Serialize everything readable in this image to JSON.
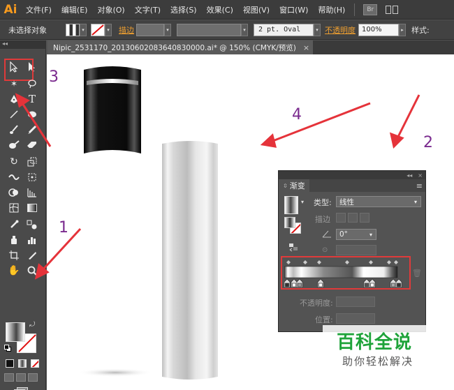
{
  "app": {
    "logo": "Ai"
  },
  "menu": [
    "文件(F)",
    "编辑(E)",
    "对象(O)",
    "文字(T)",
    "选择(S)",
    "效果(C)",
    "视图(V)",
    "窗口(W)",
    "帮助(H)"
  ],
  "menubar_right": {
    "bridge_label": "Br"
  },
  "control_bar": {
    "selection_status": "未选择对象",
    "stroke_link": "描边",
    "stroke_style": "2 pt. Oval",
    "opacity_link": "不透明度",
    "opacity_value": "100%",
    "style_label": "样式:"
  },
  "document_tab": {
    "title": "Nipic_2531170_20130602083640830000.ai* @ 150% (CMYK/预览)",
    "close": "×"
  },
  "toolbox": {
    "collapse": "◂◂"
  },
  "annotations": {
    "n1": "1",
    "n2": "2",
    "n3": "3",
    "n4": "4"
  },
  "gradient_panel": {
    "collapse": "◂◂",
    "close": "×",
    "tab_label": "渐变",
    "menu": "≡",
    "type_label": "类型:",
    "type_value": "线性",
    "stroke_label": "描边",
    "angle_value": "0°",
    "opacity_label": "不透明度:",
    "position_label": "位置:"
  },
  "watermark": {
    "title": "百科全说",
    "subtitle": "助你轻松解决"
  },
  "colors": {
    "accent_orange": "#f0a030",
    "annotation_purple": "#7a2a8e",
    "arrow_red": "#e5333a",
    "watermark_green": "#1fa33a"
  }
}
